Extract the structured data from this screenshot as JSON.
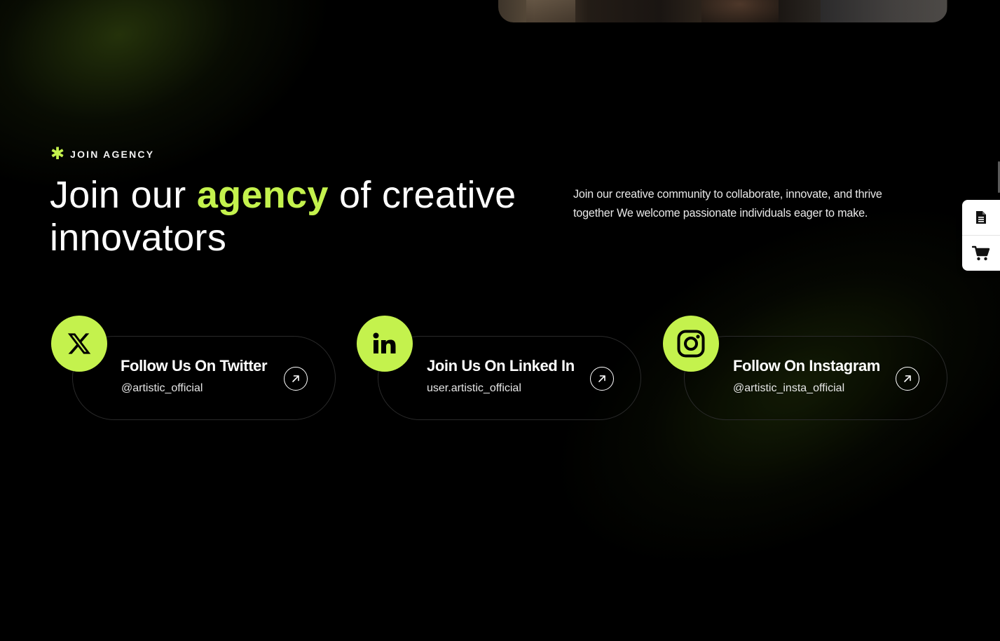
{
  "colors": {
    "accent": "#c4f24d",
    "background": "#000000",
    "text": "#ffffff"
  },
  "join_section": {
    "eyebrow_icon": "asterisk-icon",
    "eyebrow": "JOIN AGENCY",
    "headline_before": "Join our ",
    "headline_highlight": "agency",
    "headline_after": " of creative innovators",
    "description": "Join our creative community to collaborate, innovate, and thrive together We welcome passionate individuals eager to make."
  },
  "social_cards": [
    {
      "icon": "x-twitter-icon",
      "title": "Follow Us On Twitter",
      "handle": "@artistic_official",
      "arrow_icon": "arrow-up-right-icon"
    },
    {
      "icon": "linkedin-icon",
      "title": "Join Us On Linked In",
      "handle": "user.artistic_official",
      "arrow_icon": "arrow-up-right-icon"
    },
    {
      "icon": "instagram-icon",
      "title": "Follow On Instagram",
      "handle": "@artistic_insta_official",
      "arrow_icon": "arrow-up-right-icon"
    }
  ],
  "side_widget": {
    "items": [
      {
        "icon": "document-icon"
      },
      {
        "icon": "cart-icon"
      }
    ]
  }
}
